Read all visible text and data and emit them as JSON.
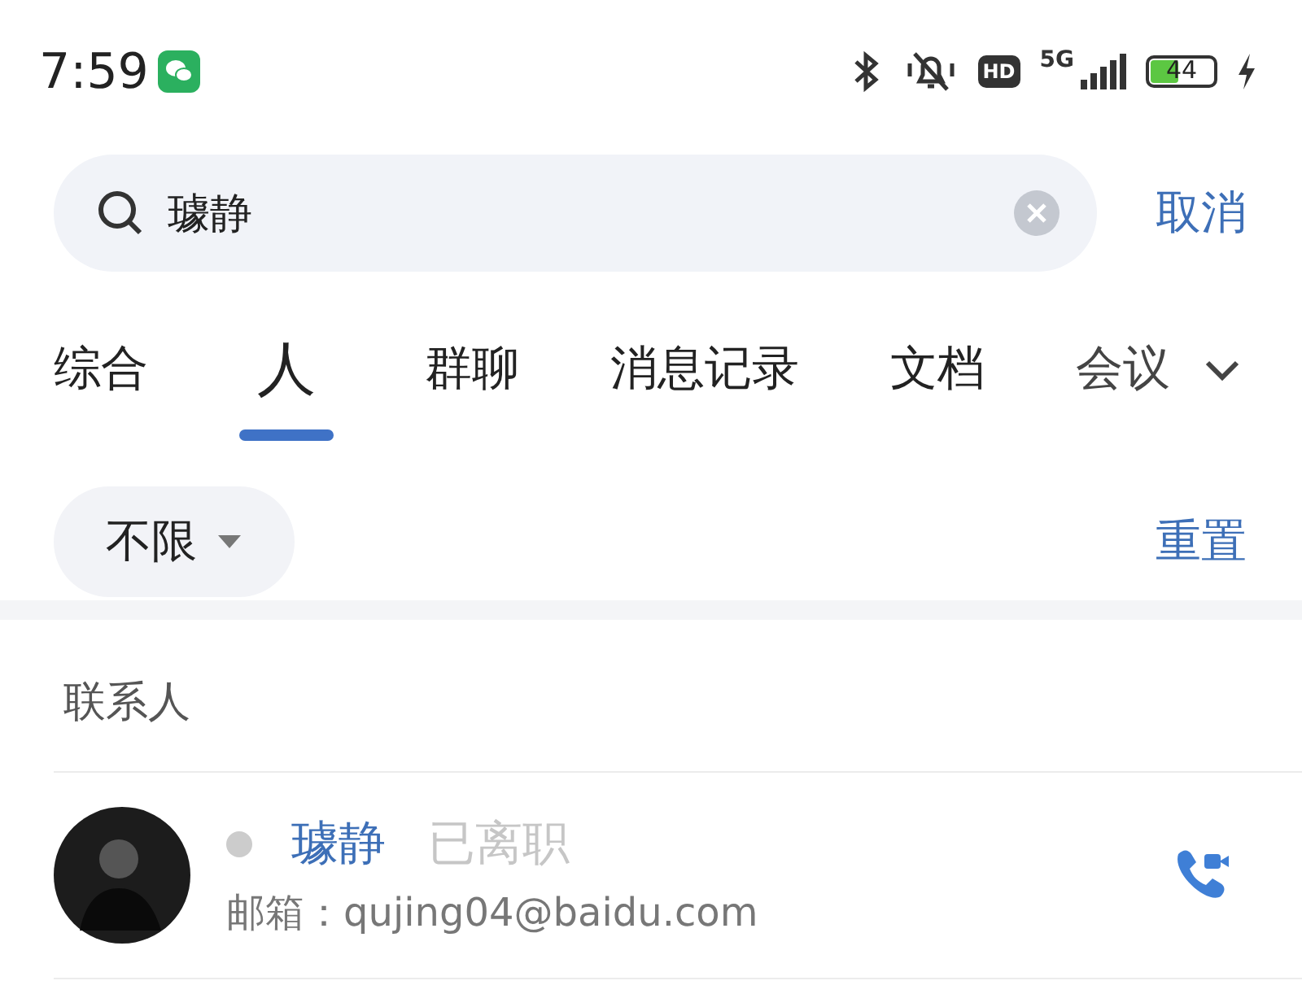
{
  "status_bar": {
    "time": "7:59",
    "battery": "44",
    "network": "5G",
    "hd_badge": "HD",
    "charging": true
  },
  "search": {
    "value": "璩静",
    "clear_button": true
  },
  "cancel_button": "取消",
  "tabs": [
    {
      "label": "综合",
      "selected": false
    },
    {
      "label": "人",
      "selected": true
    },
    {
      "label": "群聊",
      "selected": false
    },
    {
      "label": "消息记录",
      "selected": false
    },
    {
      "label": "文档",
      "selected": false
    },
    {
      "label": "会议",
      "selected": false
    }
  ],
  "filter": {
    "label": "不限"
  },
  "reset_button": "重置",
  "section": {
    "title": "联系人"
  },
  "contacts": [
    {
      "name": "璩静",
      "status": "已离职",
      "color": "#cccccc",
      "email_label": "邮箱：",
      "email": "qujing04@baidu.com"
    }
  ]
}
